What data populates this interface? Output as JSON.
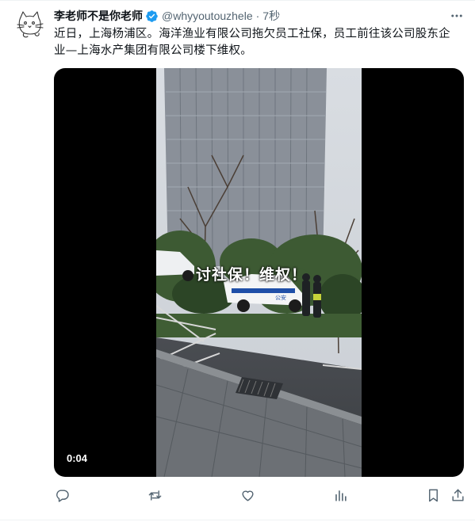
{
  "tweet": {
    "author_name": "李老师不是你老师",
    "handle": "@whyyoutouzhele",
    "separator": "·",
    "time": "7秒",
    "text_line1": "近日，上海杨浦区。海洋渔业有限公司拖欠员工社保，员工前往该公司股东企",
    "text_line2": "业—上海水产集团有限公司楼下维权。"
  },
  "media": {
    "type": "video",
    "caption_overlay": "讨社保！维权！",
    "car_marking": "公安",
    "duration": "0:04"
  },
  "icons": {
    "verified": "verified-badge-icon",
    "more": "more-icon",
    "reply": "reply-icon",
    "retweet": "retweet-icon",
    "like": "like-icon",
    "views": "views-icon",
    "bookmark": "bookmark-icon",
    "share": "share-icon"
  },
  "colors": {
    "text_primary": "#0f1419",
    "text_secondary": "#536471",
    "verified_blue": "#1d9bf0"
  }
}
